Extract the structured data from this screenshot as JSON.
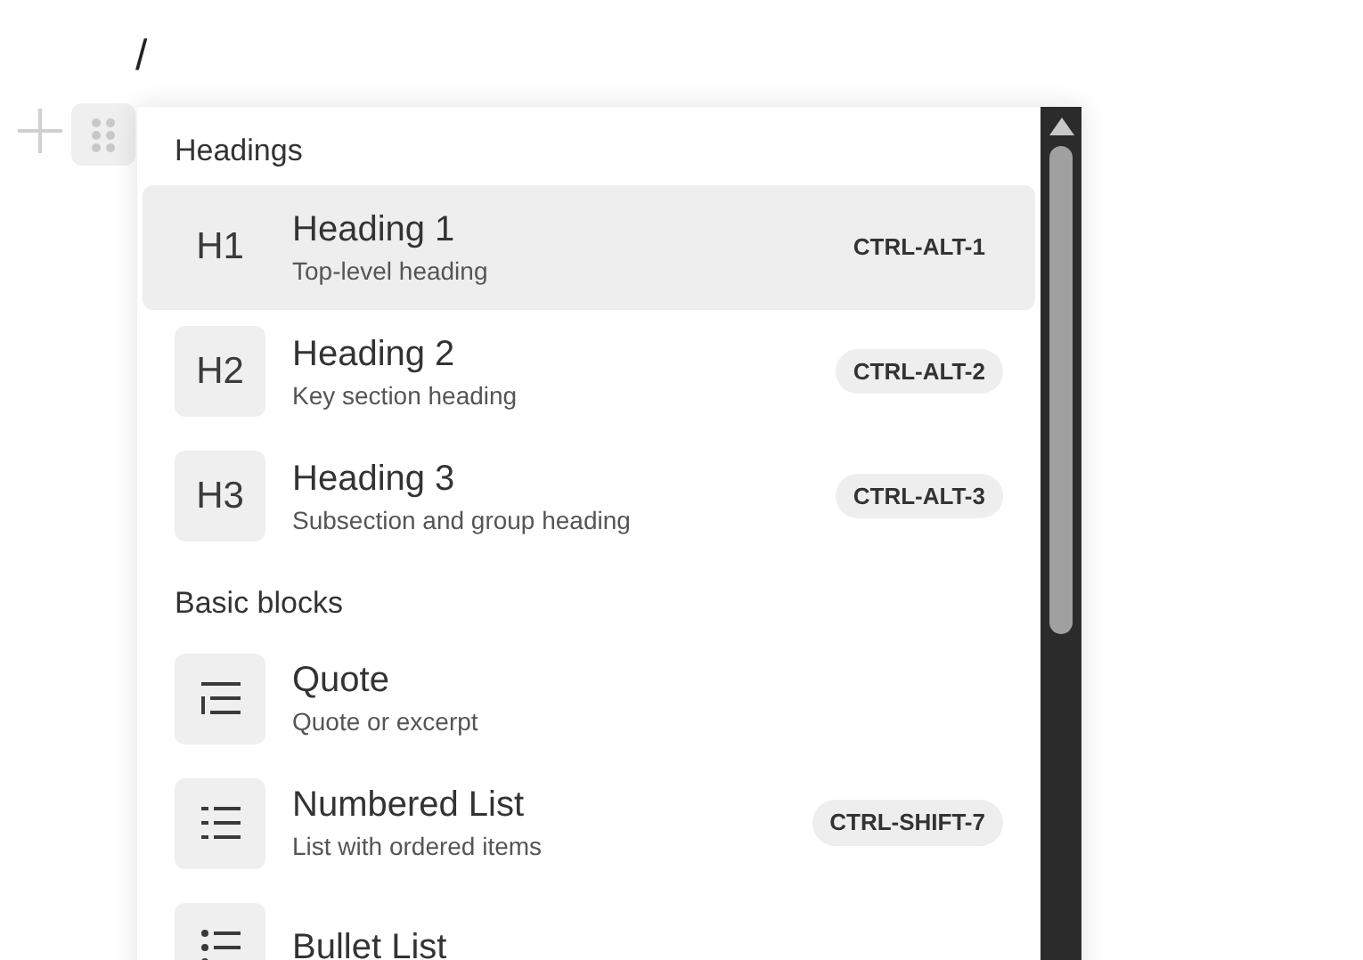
{
  "editor": {
    "typed_text": "/"
  },
  "menu": {
    "sections": [
      {
        "title": "Headings",
        "items": [
          {
            "kind": "heading",
            "icon_label": "H1",
            "title": "Heading 1",
            "subtitle": "Top-level heading",
            "shortcut": "CTRL-ALT-1",
            "selected": true
          },
          {
            "kind": "heading",
            "icon_label": "H2",
            "title": "Heading 2",
            "subtitle": "Key section heading",
            "shortcut": "CTRL-ALT-2",
            "selected": false
          },
          {
            "kind": "heading",
            "icon_label": "H3",
            "title": "Heading 3",
            "subtitle": "Subsection and group heading",
            "shortcut": "CTRL-ALT-3",
            "selected": false
          }
        ]
      },
      {
        "title": "Basic blocks",
        "items": [
          {
            "kind": "quote",
            "title": "Quote",
            "subtitle": "Quote or excerpt",
            "selected": false
          },
          {
            "kind": "numbered",
            "title": "Numbered List",
            "subtitle": "List with ordered items",
            "shortcut": "CTRL-SHIFT-7",
            "selected": false
          },
          {
            "kind": "bullet",
            "title": "Bullet List",
            "selected": false
          }
        ]
      }
    ]
  }
}
